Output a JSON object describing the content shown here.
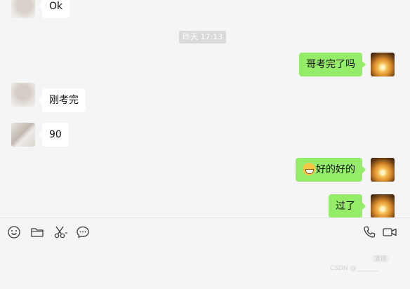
{
  "messages": [
    {
      "side": "in",
      "text": "Ok"
    },
    {
      "side": "out",
      "text": "哥考完了吗"
    },
    {
      "side": "in",
      "text": "刚考完"
    },
    {
      "side": "in",
      "text": "90"
    },
    {
      "side": "out",
      "text": "好的好的",
      "emoji": "grinning-face"
    },
    {
      "side": "out",
      "text": "过了"
    }
  ],
  "timestamp": "昨天 17:13",
  "toolbar": {
    "icons": [
      "emoji-icon",
      "folder-icon",
      "scissors-icon",
      "chat-bubble-icon",
      "phone-icon",
      "video-call-icon"
    ]
  },
  "input": {
    "value": "",
    "send_hint": "发送",
    "watermark": "CSDN @_______"
  },
  "colors": {
    "background": "#f5f5f5",
    "outgoing_bubble": "#95ec69",
    "incoming_bubble": "#ffffff",
    "timestamp_bg": "#dadada"
  }
}
